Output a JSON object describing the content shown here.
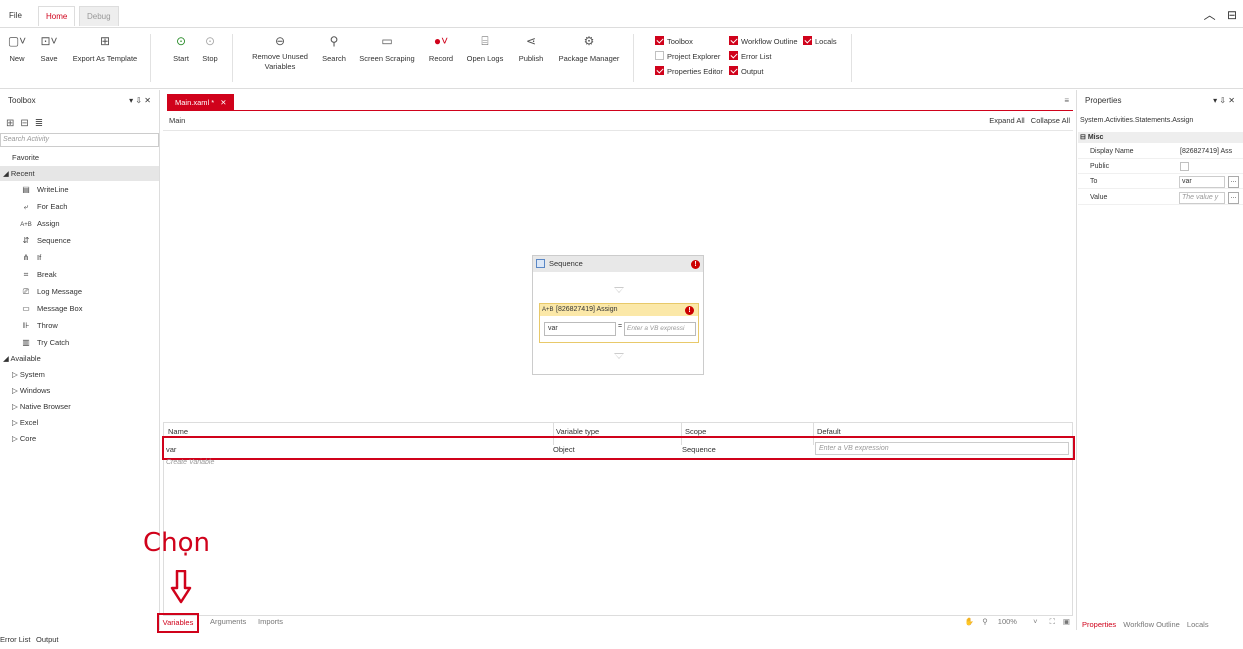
{
  "tabs": {
    "file": "File",
    "home": "Home",
    "debug": "Debug"
  },
  "ribbon": {
    "new": "New",
    "save": "Save",
    "export_template": "Export As Template",
    "start": "Start",
    "stop": "Stop",
    "remove_unused": "Remove Unused Variables",
    "search": "Search",
    "screen_scraping": "Screen Scraping",
    "record": "Record",
    "open_logs": "Open Logs",
    "publish": "Publish",
    "package_manager": "Package Manager",
    "toggles": {
      "toolbox": "Toolbox",
      "workflow_outline": "Workflow Outline",
      "locals": "Locals",
      "project_explorer": "Project Explorer",
      "error_list": "Error List",
      "properties_editor": "Properties Editor",
      "output": "Output"
    }
  },
  "toolbox": {
    "title": "Toolbox",
    "controls": "▾ ⇩ ✕",
    "search_placeholder": "Search Activity",
    "favorite": "Favorite",
    "recent": "Recent",
    "recent_items": [
      "WriteLine",
      "For Each",
      "Assign",
      "Sequence",
      "If",
      "Break",
      "Log Message",
      "Message Box",
      "Throw",
      "Try Catch"
    ],
    "available": "Available",
    "available_items": [
      "System",
      "Windows",
      "Native Browser",
      "Excel",
      "Core"
    ]
  },
  "designer": {
    "doc_tab": "Main.xaml *",
    "breadcrumb": "Main",
    "expand_all": "Expand All",
    "collapse_all": "Collapse All",
    "sequence_title": "Sequence",
    "assign_title": "[826827419] Assign",
    "assign_to": "var",
    "assign_value_placeholder": "Enter a VB expressi"
  },
  "variables": {
    "columns": [
      "Name",
      "Variable type",
      "Scope",
      "Default"
    ],
    "rows": [
      {
        "name": "var",
        "type": "Object",
        "scope": "Sequence",
        "default_placeholder": "Enter a VB expression"
      }
    ],
    "create": "Create Variable"
  },
  "bottom_tabs": {
    "variables": "Variables",
    "arguments": "Arguments",
    "imports": "Imports",
    "zoom": "100%"
  },
  "annotation": {
    "label": "Chọn"
  },
  "properties": {
    "title": "Properties",
    "type": "System.Activities.Statements.Assign",
    "category": "Misc",
    "display_name_label": "Display Name",
    "display_name_value": "[826827419] Ass",
    "public_label": "Public",
    "to_label": "To",
    "to_value": "var",
    "value_label": "Value",
    "value_placeholder": "The value y",
    "tabs": [
      "Properties",
      "Workflow Outline",
      "Locals"
    ]
  },
  "status": {
    "error_list": "Error List",
    "output": "Output"
  },
  "colors": {
    "accent": "#d0021b"
  }
}
